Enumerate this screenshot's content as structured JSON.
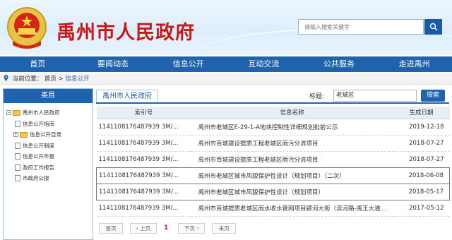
{
  "header": {
    "site_title": "禹州市人民政府",
    "search_placeholder": "请输入搜索关键字"
  },
  "nav": {
    "items": [
      "首页",
      "要闻动态",
      "信息公开",
      "互动交流",
      "公共服务",
      "走进禹州"
    ]
  },
  "breadcrumb": {
    "label": "当前位置：",
    "home": "首页",
    "separator": ">",
    "current": "信息公开"
  },
  "sidebar": {
    "title": "类目",
    "items": [
      {
        "label": "禹州市人民政府",
        "type": "folder",
        "expander": "−"
      },
      {
        "label": "信息公开指南",
        "type": "doc"
      },
      {
        "label": "信息公开目录",
        "type": "folder",
        "expander": "+"
      },
      {
        "label": "信息公开制度",
        "type": "doc"
      },
      {
        "label": "信息公开年报",
        "type": "doc"
      },
      {
        "label": "政府工作报告",
        "type": "doc"
      },
      {
        "label": "市政府公报",
        "type": "doc"
      }
    ]
  },
  "main": {
    "title": "禹州市人民政府",
    "keyword_label": "标题:",
    "keyword_value": "老城区",
    "search_button": "搜索",
    "columns": [
      "索引号",
      "信息名称",
      "生成日期"
    ],
    "rows": [
      {
        "index": "1141108176487939 3M/...",
        "name": "禹州市老城区E-29-1-A地块控制性详细规划批前公示",
        "date": "2019-12-18"
      },
      {
        "index": "1141108176487939 3M/...",
        "name": "禹州市百城建设提质工程老城区雨污分流项目",
        "date": "2018-07-27"
      },
      {
        "index": "1141108176487939 3M/...",
        "name": "禹州市百城建设提质工程老城区雨污分流项目",
        "date": "2018-07-27"
      },
      {
        "index": "1141108176487939 3M/...",
        "name": "禹州市老城区城市风貌保护性设计（规划项目）（二次）",
        "date": "2018-06-08"
      },
      {
        "index": "1141108176487939 3M/...",
        "name": "禹州市老城区城市风貌保护性设计（规划项目）",
        "date": "2018-05-17"
      },
      {
        "index": "1141108176487939 3M/...",
        "name": "禹州市百城提质老城区雨水收水管网项目颍河大街（滨河路-禹王大道...",
        "date": "2017-05-12"
      }
    ],
    "pager": {
      "first": "首页",
      "prev": "上页",
      "current": "1",
      "next": "下页",
      "last": "末页"
    }
  },
  "colors": {
    "brand_red": "#c81815",
    "nav_blue": "#1f62ad"
  }
}
